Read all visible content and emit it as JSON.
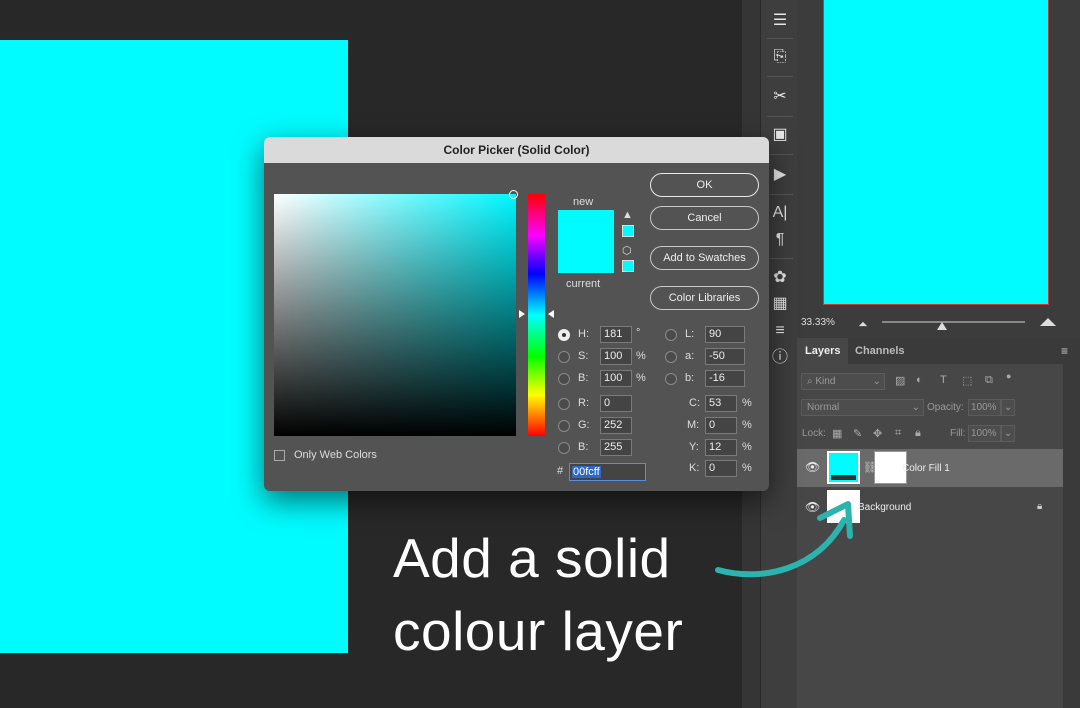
{
  "dialog": {
    "title": "Color Picker (Solid Color)",
    "buttons": [
      "OK",
      "Cancel",
      "Add to Swatches",
      "Color Libraries"
    ],
    "new_label": "new",
    "current_label": "current",
    "only_web_colors": "Only Web Colors",
    "fields": {
      "hsb": [
        {
          "label": "H:",
          "value": "181",
          "unit": "°",
          "selected": true
        },
        {
          "label": "S:",
          "value": "100",
          "unit": "%",
          "selected": false
        },
        {
          "label": "B:",
          "value": "100",
          "unit": "%",
          "selected": false
        }
      ],
      "rgb": [
        {
          "label": "R:",
          "value": "0"
        },
        {
          "label": "G:",
          "value": "252"
        },
        {
          "label": "B:",
          "value": "255"
        }
      ],
      "lab": [
        {
          "label": "L:",
          "value": "90"
        },
        {
          "label": "a:",
          "value": "-50"
        },
        {
          "label": "b:",
          "value": "-16"
        }
      ],
      "cmyk": [
        {
          "label": "C:",
          "value": "53",
          "unit": "%"
        },
        {
          "label": "M:",
          "value": "0",
          "unit": "%"
        },
        {
          "label": "Y:",
          "value": "12",
          "unit": "%"
        },
        {
          "label": "K:",
          "value": "0",
          "unit": "%"
        }
      ],
      "hex_label": "#",
      "hex": "00fcff"
    },
    "color": "#00fcff"
  },
  "navigator": {
    "zoom": "33.33%"
  },
  "layers_panel": {
    "tabs": [
      "Layers",
      "Channels"
    ],
    "filter_kind": "Kind",
    "blend_mode": "Normal",
    "opacity_label": "Opacity:",
    "opacity_value": "100%",
    "lock_label": "Lock:",
    "fill_label": "Fill:",
    "fill_value": "100%",
    "layers": [
      "Color Fill 1",
      "Background"
    ]
  },
  "annotation": {
    "line1": "Add a solid",
    "line2": "colour layer"
  }
}
